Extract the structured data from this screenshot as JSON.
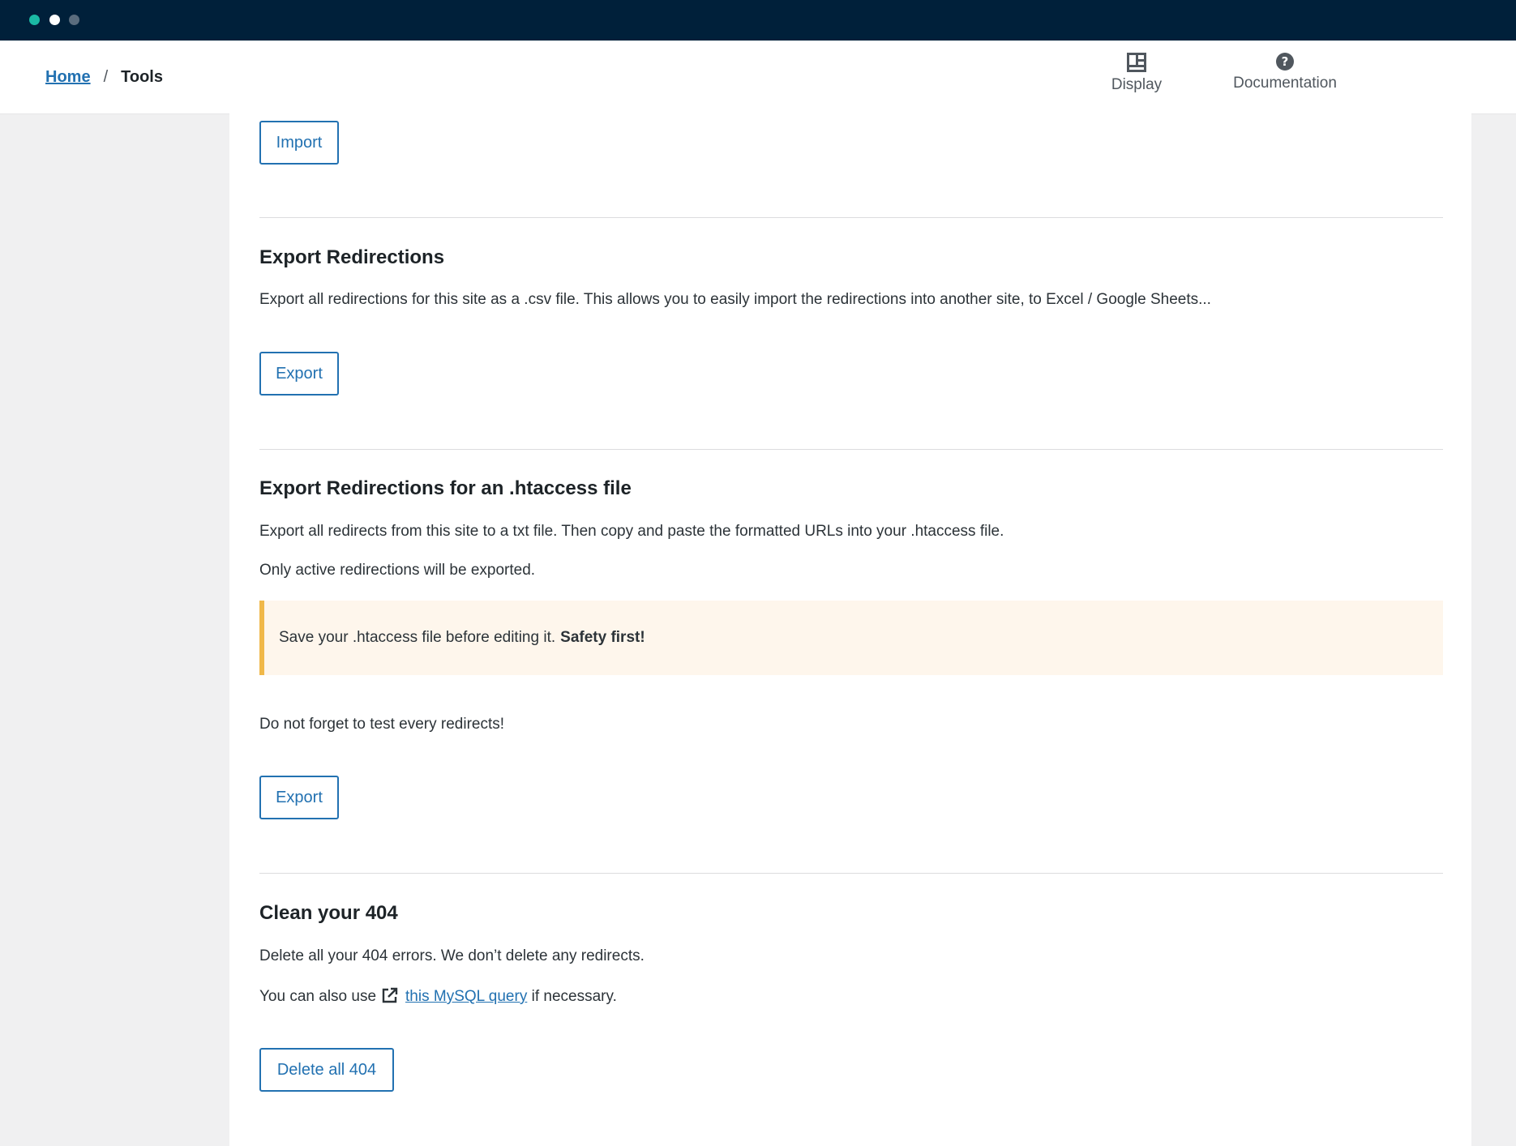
{
  "window": {
    "traffic_lights": [
      "#1bb9a4",
      "#ffffff",
      "#5a6c7d"
    ]
  },
  "breadcrumb": {
    "home": "Home",
    "separator": "/",
    "current": "Tools"
  },
  "topnav": {
    "display": {
      "label": "Display",
      "icon": "display-layout-icon"
    },
    "documentation": {
      "label": "Documentation",
      "icon": "help-circle-icon"
    }
  },
  "import_section": {
    "button": "Import"
  },
  "export_section": {
    "title": "Export Redirections",
    "description": "Export all redirections for this site as a .csv file. This allows you to easily import the redirections into another site, to Excel / Google Sheets...",
    "button": "Export"
  },
  "htaccess_section": {
    "title": "Export Redirections for an .htaccess file",
    "description": "Export all redirects from this site to a txt file. Then copy and paste the formatted URLs into your .htaccess file.",
    "note": "Only active redirections will be exported.",
    "notice_text": "Save your .htaccess file before editing it.",
    "notice_strong": "Safety first!",
    "reminder": "Do not forget to test every redirects!",
    "button": "Export"
  },
  "clean404_section": {
    "title": "Clean your 404",
    "description": "Delete all your 404 errors. We don’t delete any redirects.",
    "query_prefix": "You can also use",
    "query_link": "this MySQL query",
    "query_suffix": "if necessary.",
    "button": "Delete all 404"
  },
  "colors": {
    "accent": "#2271b1",
    "titlebar": "#00203a",
    "notice_border": "#f0b849",
    "notice_background": "#fef6ec"
  }
}
